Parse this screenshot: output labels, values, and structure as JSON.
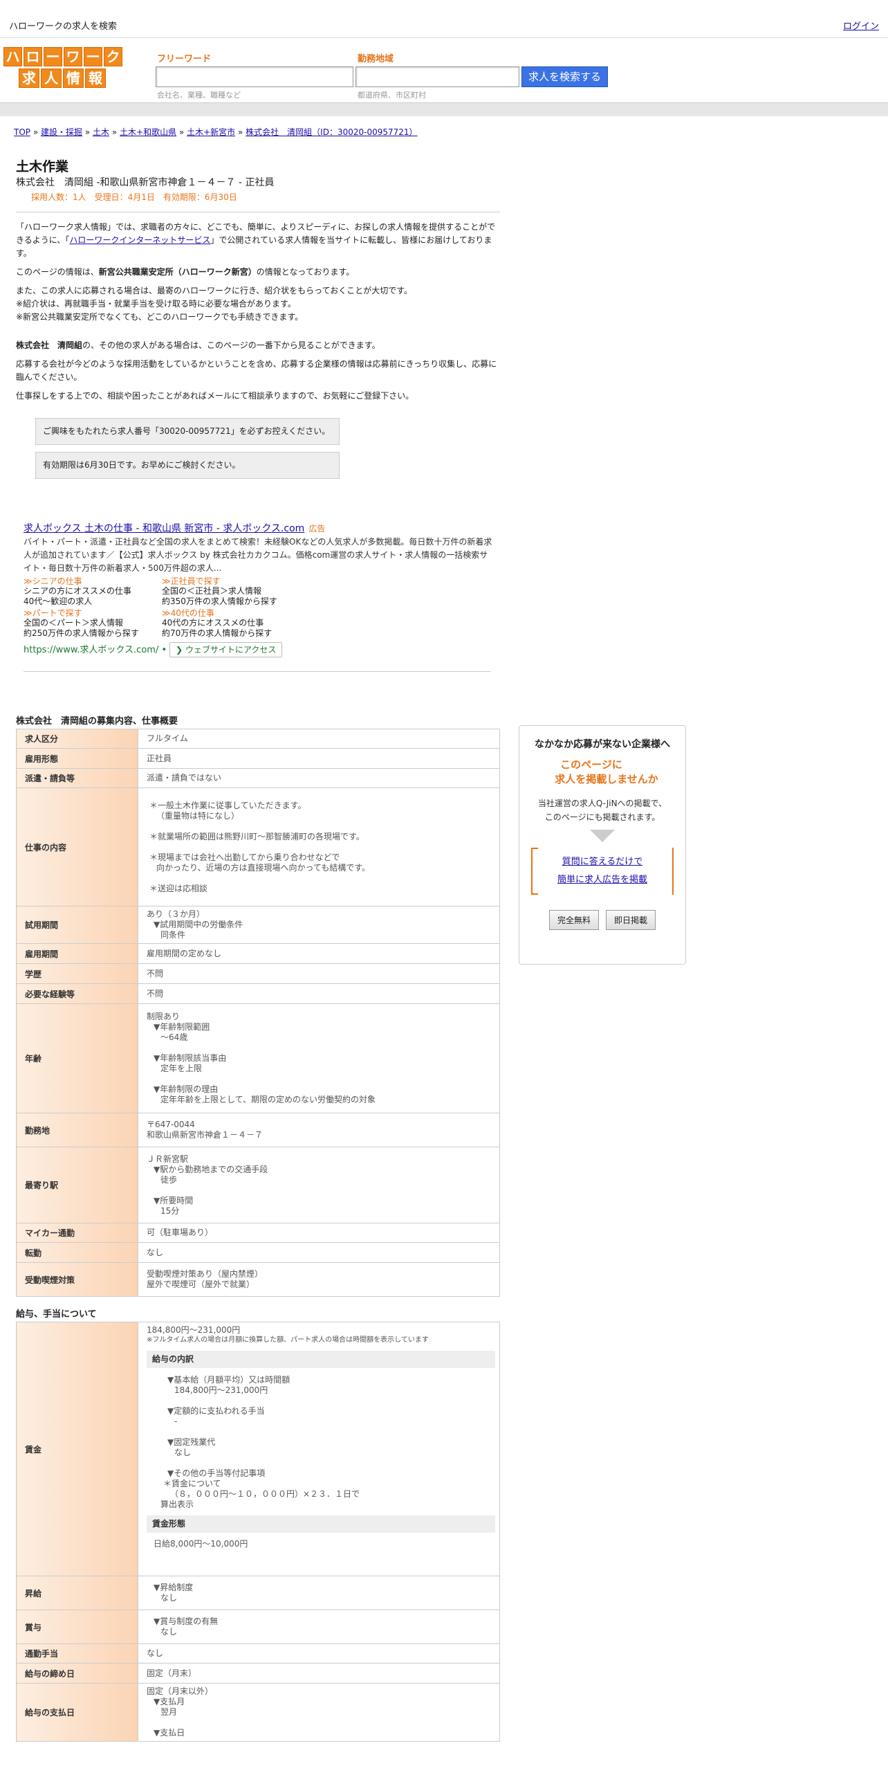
{
  "topbar": {
    "title": "ハローワークの求人を検索",
    "login": "ログイン"
  },
  "logo": {
    "row1": [
      "ハ",
      "ロ",
      "ー",
      "ワ",
      "ー",
      "ク"
    ],
    "row2": [
      "求",
      "人",
      "情",
      "報"
    ]
  },
  "search": {
    "freeword_label": "フリーワード",
    "freeword_hint": "会社名、業種、職種など",
    "area_label": "勤務地域",
    "area_hint": "都道府県、市区町村",
    "button": "求人を検索する"
  },
  "breadcrumb": [
    "TOP",
    "建設・採掘",
    "土木",
    "土木+和歌山県",
    "土木+新宮市",
    "株式会社　清岡組（ID：30020-00957721）"
  ],
  "breadcrumb_sep": "»",
  "job": {
    "title": "土木作業",
    "company_line": "株式会社　清岡組 -和歌山県新宮市神倉１－４－７ - 正社員",
    "meta": "採用人数：1人　受理日：4月1日　有効期限：6月30日"
  },
  "intro": {
    "p1_a": "「ハローワーク求人情報」では、求職者の方々に、どこでも、簡単に、よりスピーディに、お探しの求人情報を提供することができるように、「",
    "p1_link": "ハローワークインターネットサービス",
    "p1_b": "」で公開されている求人情報を当サイトに転載し、皆様にお届けしております。",
    "p2_a": "このページの情報は、",
    "p2_bold": "新宮公共職業安定所（ハローワーク新宮）",
    "p2_b": "の情報となっております。",
    "p3_l1": "また、この求人に応募される場合は、最寄のハローワークに行き、紹介状をもらっておくことが大切です。",
    "p3_l2": "※紹介状は、再就職手当・就業手当を受け取る時に必要な場合があります。",
    "p3_l3": "※新宮公共職業安定所でなくても、どこのハローワークでも手続きできます。",
    "p4_bold": "株式会社　清岡組",
    "p4_b": "の、その他の求人がある場合は、このページの一番下から見ることができます。",
    "p5": "応募する会社が今どのような採用活動をしているかということを含め、応募する企業様の情報は応募前にきっちり収集し、応募に臨んでください。",
    "p6": "仕事探しをする上での、相談や困ったことがあればメールにて相談承りますので、お気軽にご登録下さい。",
    "notice1": "ご興味をもたれたら求人番号「30020-00957721」を必ずお控えください。",
    "notice2": "有効期限は6月30日です。お早めにご検討ください。"
  },
  "ad": {
    "title": "求人ボックス 土木の仕事 - 和歌山県 新宮市 - 求人ボックス.com",
    "badge": "広告",
    "desc": "バイト・パート・派遣・正社員など全国の求人をまとめて検索！未経験OKなどの人気求人が多数掲載。毎日数十万件の新着求人が追加されています／【公式】求人ボックス by 株式会社カカクコム。価格com運営の求人サイト・求人情報の一括検索サイト・毎日数十万件の新着求人・500万件超の求人...",
    "links": [
      {
        "title": "≫シニアの仕事",
        "d1": "シニアの方にオススメの仕事",
        "d2": "40代～歓迎の求人"
      },
      {
        "title": "≫正社員で探す",
        "d1": "全国の＜正社員＞求人情報",
        "d2": "約350万件の求人情報から探す"
      },
      {
        "title": "≫パートで探す",
        "d1": "全国の＜パート＞求人情報",
        "d2": "約250万件の求人情報から探す"
      },
      {
        "title": "≫40代の仕事",
        "d1": "40代の方にオススメの仕事",
        "d2": "約70万件の求人情報から探す"
      }
    ],
    "url": "https://www.求人ボックス.com/",
    "dot": "•",
    "visit": "❯ ウェブサイトにアクセス"
  },
  "detail": {
    "title": "株式会社　清岡組の募集内容、仕事概要",
    "rows": [
      {
        "h": "求人区分",
        "v": [
          "フルタイム"
        ]
      },
      {
        "h": "雇用形態",
        "v": [
          "正社員"
        ]
      },
      {
        "h": "派遣・請負等",
        "v": [
          "派遣・請負ではない"
        ]
      },
      {
        "h": "仕事の内容",
        "v": [
          "＊一般土木作業に従事していただきます。",
          "（重量物は特になし）",
          "",
          "＊就業場所の範囲は熊野川町～那智勝浦町の各現場です。",
          "",
          "＊現場までは会社へ出勤してから乗り合わせなどで",
          "向かったり、近場の方は直接現場へ向かっても結構です。",
          "",
          "＊送迎は応相談"
        ]
      },
      {
        "h": "試用期間",
        "v": [
          "あり（３か月）",
          "▼試用期間中の労働条件",
          "同条件"
        ]
      },
      {
        "h": "雇用期間",
        "v": [
          "雇用期間の定めなし"
        ]
      },
      {
        "h": "学歴",
        "v": [
          "不問"
        ]
      },
      {
        "h": "必要な経験等",
        "v": [
          "不問"
        ]
      },
      {
        "h": "年齢",
        "v": [
          "制限あり",
          "▼年齢制限範囲",
          "～64歳",
          "",
          "▼年齢制限該当事由",
          "定年を上限",
          "",
          "▼年齢制限の理由",
          "定年年齢を上限として、期限の定めのない労働契約の対象"
        ]
      },
      {
        "h": "勤務地",
        "v": [
          "〒647-0044",
          "和歌山県新宮市神倉１－４－７"
        ]
      },
      {
        "h": "最寄り駅",
        "v": [
          "ＪＲ新宮駅",
          "▼駅から勤務地までの交通手段",
          "徒歩",
          "",
          "▼所要時間",
          "15分"
        ]
      },
      {
        "h": "マイカー通勤",
        "v": [
          "可（駐車場あり）"
        ]
      },
      {
        "h": "転勤",
        "v": [
          "なし"
        ]
      },
      {
        "h": "受動喫煙対策",
        "v": [
          "受動喫煙対策あり（屋内禁煙）",
          "屋外で喫煙可（屋外で就業）"
        ]
      }
    ]
  },
  "salary": {
    "title": "給与、手当について",
    "wage_h": "賃金",
    "wage_range": "184,800円〜231,000円",
    "wage_note": "※フルタイム求人の場合は月額に換算した額、パート求人の場合は時間額を表示しています",
    "breakdown_title": "給与の内訳",
    "breakdown": [
      "▼基本給（月額平均）又は時間額",
      "184,800円〜231,000円",
      "",
      "▼定額的に支払われる手当",
      "-",
      "",
      "▼固定残業代",
      "なし",
      "",
      "▼その他の手当等付記事項",
      "＊賃金について",
      "（８，０００円～１０，０００円）×２３．１日で",
      "算出表示"
    ],
    "form_title": "賃金形態",
    "form_value": "日給8,000円〜10,000円",
    "rows": [
      {
        "h": "昇給",
        "v": [
          "▼昇給制度",
          "なし"
        ]
      },
      {
        "h": "賞与",
        "v": [
          "▼賞与制度の有無",
          "なし"
        ]
      },
      {
        "h": "通勤手当",
        "v": [
          "なし"
        ]
      },
      {
        "h": "給与の締め日",
        "v": [
          "固定（月末）"
        ]
      },
      {
        "h": "給与の支払日",
        "v": [
          "固定（月末以外）",
          "▼支払月",
          "翌月",
          "",
          "▼支払日"
        ]
      }
    ]
  },
  "side": {
    "title": "なかなか応募が来ない企業様へ",
    "offer1": "このページに",
    "offer2": "求人を掲載しませんか",
    "desc1": "当社運営の求人Q-JiNへの掲載で、",
    "desc2": "このページにも掲載されます。",
    "link1": "質問に答えるだけで",
    "link2": "簡単に求人広告を掲載",
    "btn1": "完全無料",
    "btn2": "即日掲載"
  }
}
